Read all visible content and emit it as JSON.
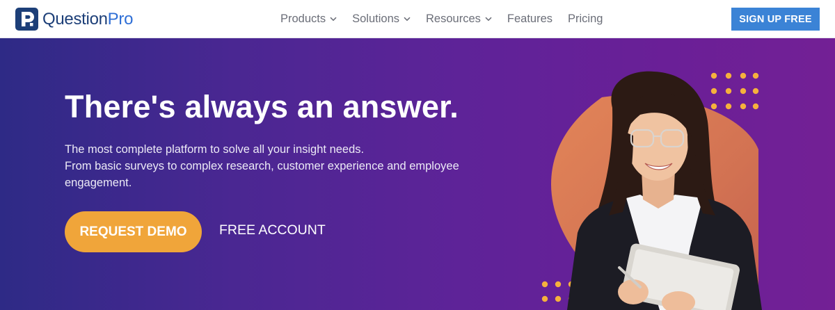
{
  "brand": {
    "name_part1": "Question",
    "name_part2": "Pro",
    "logo_letter": "P",
    "color_primary": "#1d3f78",
    "color_accent": "#2f6fd6"
  },
  "nav": {
    "items": [
      {
        "label": "Products",
        "has_dropdown": true
      },
      {
        "label": "Solutions",
        "has_dropdown": true
      },
      {
        "label": "Resources",
        "has_dropdown": true
      },
      {
        "label": "Features",
        "has_dropdown": false
      },
      {
        "label": "Pricing",
        "has_dropdown": false
      }
    ]
  },
  "header": {
    "signup_label": "SIGN UP FREE",
    "signup_color": "#3b83d6"
  },
  "hero": {
    "title": "There's always an answer.",
    "subtitle_line1": "The most complete platform to solve all your insight needs.",
    "subtitle_line2": "From basic surveys to complex research, customer experience and employee engagement.",
    "cta_primary": "REQUEST DEMO",
    "cta_secondary": "FREE ACCOUNT",
    "cta_primary_color": "#f0a53a",
    "image": "smiling-woman-with-tablet"
  }
}
